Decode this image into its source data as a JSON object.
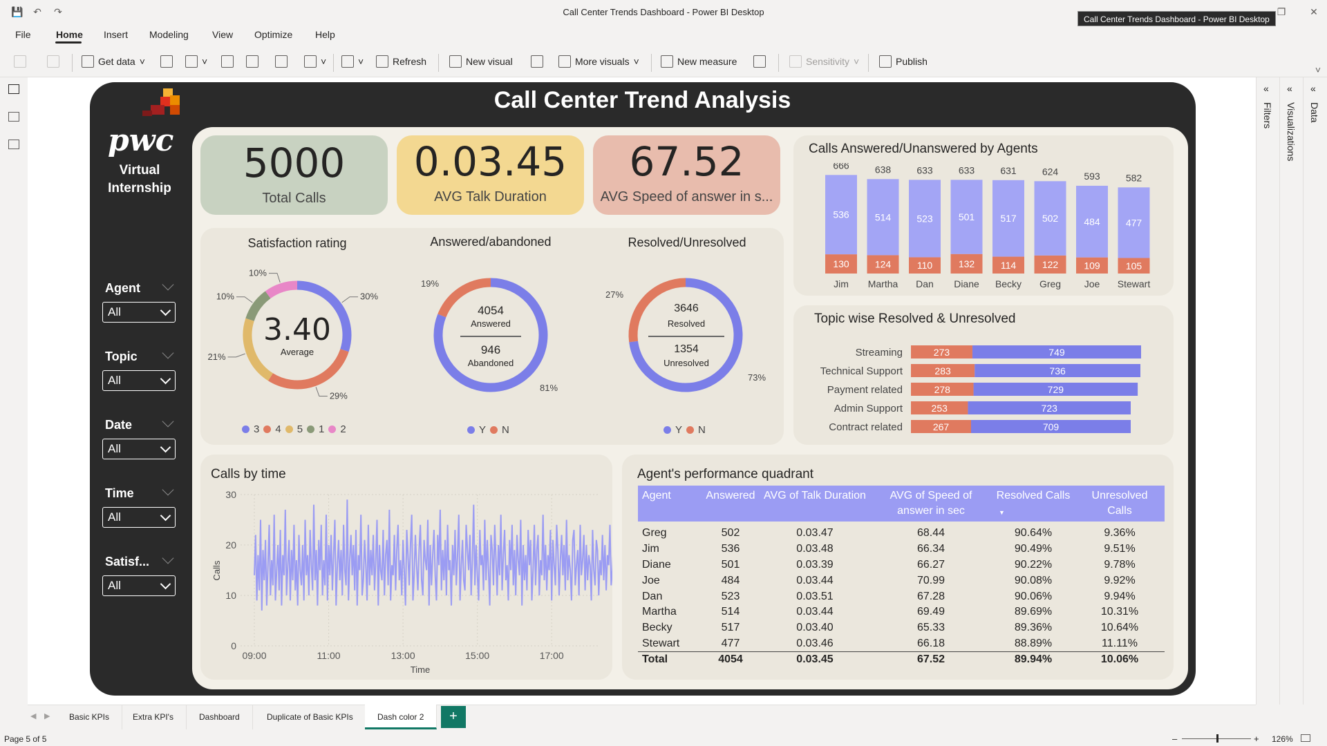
{
  "window": {
    "title": "Call Center Trends Dashboard - Power BI Desktop",
    "tooltip": "Call Center Trends Dashboard - Power BI Desktop"
  },
  "menu": [
    "File",
    "Home",
    "Insert",
    "Modeling",
    "View",
    "Optimize",
    "Help"
  ],
  "ribbon": {
    "get_data": "Get data",
    "refresh": "Refresh",
    "new_visual": "New visual",
    "more_visuals": "More visuals",
    "new_measure": "New measure",
    "sensitivity": "Sensitivity",
    "publish": "Publish"
  },
  "panes": {
    "filters": "Filters",
    "visualizations": "Visualizations",
    "data": "Data"
  },
  "report": {
    "title": "Call Center Trend Analysis",
    "brand": "pwc",
    "brand_sub": "Virtual Internship"
  },
  "slicers": [
    {
      "label": "Agent",
      "value": "All"
    },
    {
      "label": "Topic",
      "value": "All"
    },
    {
      "label": "Date",
      "value": "All"
    },
    {
      "label": "Time",
      "value": "All"
    },
    {
      "label": "Satisf...",
      "value": "All"
    }
  ],
  "kpis": [
    {
      "value": "5000",
      "label": "Total Calls",
      "color": "#c8d2c1"
    },
    {
      "value": "0.03.45",
      "label": "AVG Talk Duration",
      "color": "#f3d891"
    },
    {
      "value": "67.52",
      "label": "AVG Speed of answer in s...",
      "color": "#e8bcad"
    }
  ],
  "satisfaction": {
    "title": "Satisfaction rating",
    "center_value": "3.40",
    "center_label": "Average",
    "segments": [
      {
        "name": "3",
        "pct": 30,
        "label": "30%",
        "color": "#7b7ee8"
      },
      {
        "name": "4",
        "pct": 29,
        "label": "29%",
        "color": "#e07a5f"
      },
      {
        "name": "5",
        "pct": 21,
        "label": "21%",
        "color": "#e0b96a"
      },
      {
        "name": "1",
        "pct": 10,
        "label": "10%",
        "color": "#8a9a78"
      },
      {
        "name": "2",
        "pct": 10,
        "label": "10%",
        "color": "#e887c7"
      }
    ]
  },
  "answered": {
    "title": "Answered/abandoned",
    "top_value": "4054",
    "top_label": "Answered",
    "bottom_value": "946",
    "bottom_label": "Abandoned",
    "pct_y": "81%",
    "pct_n": "19%",
    "legend": [
      "Y",
      "N"
    ]
  },
  "resolved": {
    "title": "Resolved/Unresolved",
    "top_value": "3646",
    "top_label": "Resolved",
    "bottom_value": "1354",
    "bottom_label": "Unresolved",
    "pct_y": "73%",
    "pct_n": "27%",
    "legend": [
      "Y",
      "N"
    ]
  },
  "agents_chart": {
    "title": "Calls Answered/Unanswered by Agents"
  },
  "topics_chart": {
    "title": "Topic wise Resolved & Unresolved"
  },
  "time_chart": {
    "title": "Calls by time",
    "ylabel": "Calls",
    "xlabel": "Time"
  },
  "quadrant": {
    "title": "Agent's performance quadrant",
    "columns": [
      "Agent",
      "Answered",
      "AVG of Talk Duration",
      "AVG of Speed of answer in sec",
      "Resolved Calls",
      "Unresolved Calls"
    ],
    "rows": [
      [
        "Greg",
        "502",
        "0.03.47",
        "68.44",
        "90.64%",
        "9.36%"
      ],
      [
        "Jim",
        "536",
        "0.03.48",
        "66.34",
        "90.49%",
        "9.51%"
      ],
      [
        "Diane",
        "501",
        "0.03.39",
        "66.27",
        "90.22%",
        "9.78%"
      ],
      [
        "Joe",
        "484",
        "0.03.44",
        "70.99",
        "90.08%",
        "9.92%"
      ],
      [
        "Dan",
        "523",
        "0.03.51",
        "67.28",
        "90.06%",
        "9.94%"
      ],
      [
        "Martha",
        "514",
        "0.03.44",
        "69.49",
        "89.69%",
        "10.31%"
      ],
      [
        "Becky",
        "517",
        "0.03.40",
        "65.33",
        "89.36%",
        "10.64%"
      ],
      [
        "Stewart",
        "477",
        "0.03.46",
        "66.18",
        "88.89%",
        "11.11%"
      ]
    ],
    "total": [
      "Total",
      "4054",
      "0.03.45",
      "67.52",
      "89.94%",
      "10.06%"
    ]
  },
  "tabs": [
    "Basic KPIs",
    "Extra KPI's",
    "Dashboard",
    "Duplicate of Basic KPIs",
    "Dash color 2"
  ],
  "active_tab": "Dash color 2",
  "status": {
    "page": "Page 5 of 5",
    "zoom": "126%"
  },
  "colors": {
    "y": "#7b7ee8",
    "n": "#e07a5f",
    "dark": "#2a2a2a",
    "canvas": "#f3f0e8"
  },
  "chart_data": [
    {
      "type": "bar",
      "name_ref": "agents",
      "categories": [
        "Jim",
        "Martha",
        "Dan",
        "Diane",
        "Becky",
        "Greg",
        "Joe",
        "Stewart"
      ],
      "totals": [
        666,
        638,
        633,
        633,
        631,
        624,
        593,
        582
      ],
      "series": [
        {
          "values": [
            536,
            514,
            523,
            501,
            517,
            502,
            484,
            477
          ]
        },
        {
          "values": [
            130,
            124,
            110,
            132,
            114,
            122,
            109,
            105
          ]
        }
      ]
    },
    {
      "type": "bar",
      "name_ref": "topics",
      "categories": [
        "Streaming",
        "Technical Support",
        "Payment related",
        "Admin Support",
        "Contract related"
      ],
      "series": [
        {
          "values": [
            273,
            283,
            278,
            253,
            267
          ]
        },
        {
          "values": [
            749,
            736,
            729,
            723,
            709
          ]
        }
      ]
    },
    {
      "type": "line",
      "name_ref": "time",
      "xticks": [
        "09:00",
        "11:00",
        "13:00",
        "15:00",
        "17:00"
      ],
      "yticks": [
        "0",
        "10",
        "20",
        "30"
      ],
      "ylim": [
        0,
        30
      ],
      "x_start_min": 540,
      "x_step_min": 2,
      "x_end_min": 1080,
      "values": [
        14,
        22,
        9,
        18,
        11,
        25,
        7,
        19,
        13,
        21,
        8,
        16,
        24,
        10,
        17,
        12,
        26,
        9,
        15,
        20,
        11,
        23,
        8,
        18,
        14,
        27,
        10,
        16,
        21,
        9,
        19,
        13,
        24,
        11,
        17,
        8,
        22,
        15,
        12,
        20,
        9,
        25,
        14,
        18,
        10,
        23,
        16,
        11,
        28,
        13,
        19,
        8,
        21,
        15,
        24,
        10,
        17,
        12,
        26,
        9,
        20,
        14,
        22,
        11,
        18,
        25,
        8,
        16,
        21,
        13,
        19,
        10,
        24,
        15,
        12,
        29,
        9,
        17,
        22,
        14,
        20,
        11,
        23,
        8,
        18,
        15,
        26,
        10,
        13,
        21,
        16,
        9,
        24,
        12,
        19,
        14,
        22,
        11,
        17,
        25,
        8,
        20,
        15,
        13,
        23,
        10,
        18,
        21,
        12,
        27,
        9,
        16,
        14,
        22,
        11,
        19,
        24,
        13,
        17,
        10,
        21,
        15,
        8,
        23,
        18,
        12,
        20,
        26,
        9,
        14,
        22,
        16,
        11,
        19,
        24,
        13,
        10,
        21,
        17,
        15,
        25,
        8,
        20,
        12,
        18,
        23,
        14,
        9,
        22,
        16,
        27,
        11,
        19,
        13,
        21,
        10,
        24,
        15,
        17,
        8,
        20,
        14,
        23,
        12,
        18,
        26,
        9,
        16,
        21,
        13,
        11,
        24,
        19,
        15,
        22,
        10,
        17,
        28,
        12,
        20,
        14,
        9,
        23,
        16,
        18,
        11,
        25,
        13,
        21,
        15,
        8,
        22,
        19,
        12,
        24,
        17,
        10,
        20,
        14,
        26,
        11,
        18,
        23,
        13,
        16,
        9,
        21,
        15,
        24,
        12,
        19,
        10,
        22,
        17,
        14,
        25,
        8,
        20,
        13,
        18,
        11,
        23,
        16,
        21,
        9,
        15,
        24,
        12,
        19,
        22,
        10,
        17,
        14,
        26,
        13,
        20,
        11,
        18,
        15,
        23,
        9,
        21,
        16,
        12,
        24,
        19,
        10,
        17,
        22,
        14,
        20,
        11,
        25,
        13,
        18,
        15,
        9,
        21,
        23,
        12,
        16,
        19,
        10,
        24,
        14,
        17,
        22,
        11,
        20,
        13,
        18,
        16,
        9,
        23,
        15,
        12,
        21,
        19,
        10,
        17,
        14,
        22,
        13,
        20,
        11,
        18,
        16,
        24,
        12,
        15,
        21,
        10,
        19,
        14,
        17,
        22,
        11,
        20,
        13,
        16,
        18,
        12,
        23,
        15,
        10,
        19,
        21,
        14,
        17,
        11,
        20,
        13,
        16,
        22,
        12,
        18,
        15,
        19,
        14,
        20,
        11,
        17,
        13,
        21,
        16,
        12,
        18,
        15,
        19,
        14,
        20,
        13,
        17,
        16,
        18,
        15,
        19,
        14
      ]
    }
  ]
}
